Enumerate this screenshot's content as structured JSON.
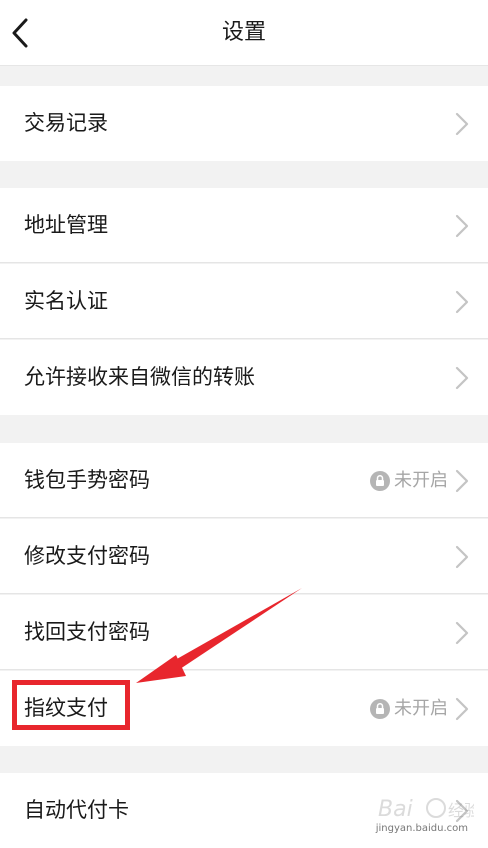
{
  "header": {
    "title": "设置",
    "back_icon": "chevron-left-icon"
  },
  "rows": [
    {
      "label": "交易记录"
    },
    {
      "label": "地址管理"
    },
    {
      "label": "实名认证"
    },
    {
      "label": "允许接收来自微信的转账"
    },
    {
      "label": "钱包手势密码",
      "status": "未开启"
    },
    {
      "label": "修改支付密码"
    },
    {
      "label": "找回支付密码"
    },
    {
      "label": "指纹支付",
      "status": "未开启"
    },
    {
      "label": "自动代付卡"
    }
  ],
  "colors": {
    "background": "#f2f2f2",
    "row": "#ffffff",
    "text": "#1a1a1a",
    "muted": "#a6a6a6",
    "highlight": "#e8262d"
  },
  "watermark": {
    "text": "jingyan.baidu.com"
  }
}
